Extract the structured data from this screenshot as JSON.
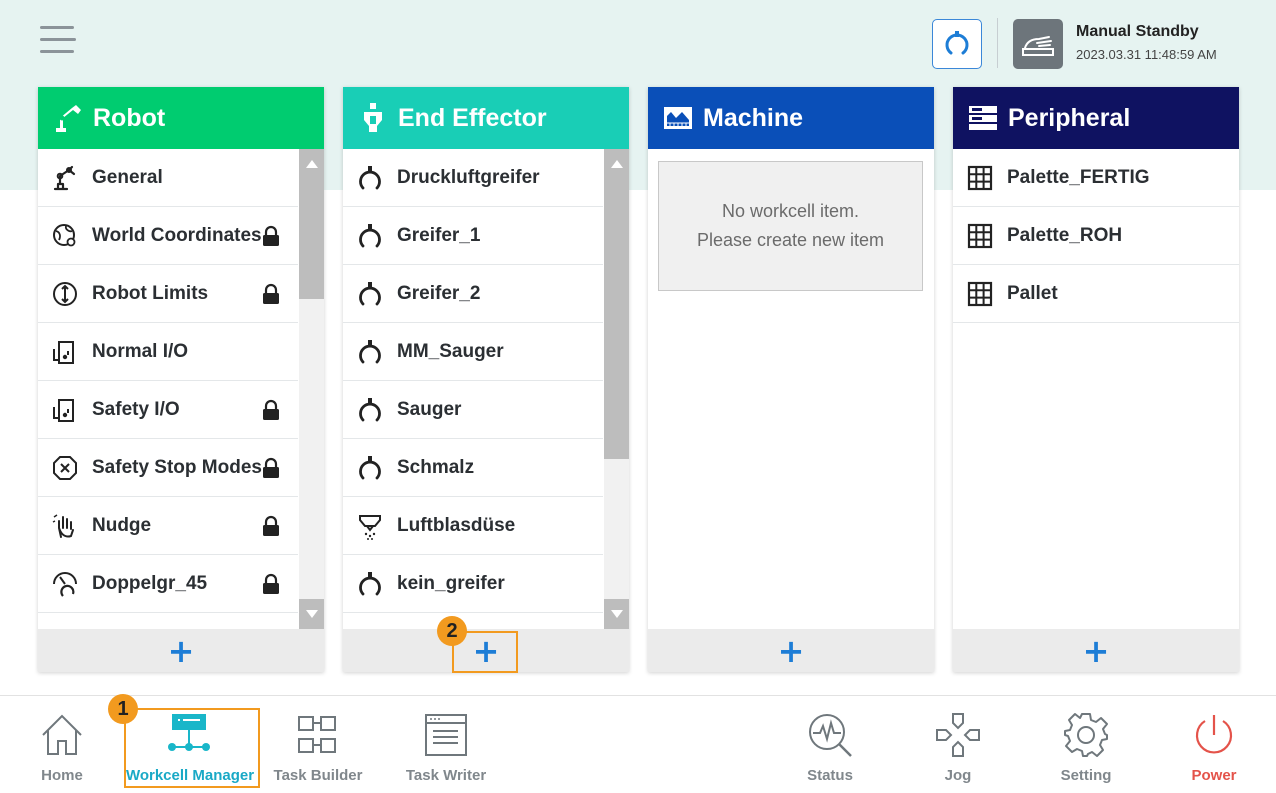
{
  "header": {
    "status_title": "Manual Standby",
    "status_time": "2023.03.31 11:48:59 AM"
  },
  "colors": {
    "robot": "#00cc70",
    "end_effector": "#19ceb6",
    "machine": "#0a4fb8",
    "peripheral": "#0f1261",
    "accent": "#1d7dd6",
    "callout": "#f29a1f",
    "power": "#e4534a"
  },
  "panels": {
    "robot": {
      "title": "Robot",
      "items": [
        {
          "label": "General",
          "icon": "robot-arm-icon",
          "locked": false
        },
        {
          "label": "World Coordinates",
          "icon": "globe-coordinates-icon",
          "locked": true
        },
        {
          "label": "Robot Limits",
          "icon": "limits-icon",
          "locked": true
        },
        {
          "label": "Normal I/O",
          "icon": "io-icon",
          "locked": false
        },
        {
          "label": "Safety I/O",
          "icon": "safety-io-icon",
          "locked": true
        },
        {
          "label": "Safety Stop Modes",
          "icon": "stop-octagon-icon",
          "locked": true
        },
        {
          "label": "Nudge",
          "icon": "hand-touch-icon",
          "locked": true
        },
        {
          "label": "Doppelgr_45",
          "icon": "gauge-gripper-icon",
          "locked": true
        }
      ],
      "add_label": "+"
    },
    "end_effector": {
      "title": "End Effector",
      "items": [
        {
          "label": "Druckluftgreifer",
          "icon": "gripper-icon"
        },
        {
          "label": "Greifer_1",
          "icon": "gripper-icon"
        },
        {
          "label": "Greifer_2",
          "icon": "gripper-icon"
        },
        {
          "label": "MM_Sauger",
          "icon": "gripper-icon"
        },
        {
          "label": "Sauger",
          "icon": "gripper-icon"
        },
        {
          "label": "Schmalz",
          "icon": "gripper-icon"
        },
        {
          "label": "Luftblasdüse",
          "icon": "air-nozzle-icon"
        },
        {
          "label": "kein_greifer",
          "icon": "gripper-icon"
        }
      ],
      "add_label": "+"
    },
    "machine": {
      "title": "Machine",
      "empty_line1": "No workcell item.",
      "empty_line2": "Please create new item",
      "add_label": "+"
    },
    "peripheral": {
      "title": "Peripheral",
      "items": [
        {
          "label": "Palette_FERTIG",
          "icon": "grid-icon"
        },
        {
          "label": "Palette_ROH",
          "icon": "grid-icon"
        },
        {
          "label": "Pallet",
          "icon": "grid-icon"
        }
      ],
      "add_label": "+"
    }
  },
  "callouts": [
    "1",
    "2"
  ],
  "nav": [
    {
      "label": "Home",
      "icon": "home-icon"
    },
    {
      "label": "Workcell Manager",
      "icon": "workcell-icon",
      "active": true
    },
    {
      "label": "Task Builder",
      "icon": "task-builder-icon"
    },
    {
      "label": "Task Writer",
      "icon": "task-writer-icon"
    },
    {
      "label": "Status",
      "icon": "status-icon"
    },
    {
      "label": "Jog",
      "icon": "jog-icon"
    },
    {
      "label": "Setting",
      "icon": "gear-icon"
    },
    {
      "label": "Power",
      "icon": "power-icon"
    }
  ]
}
